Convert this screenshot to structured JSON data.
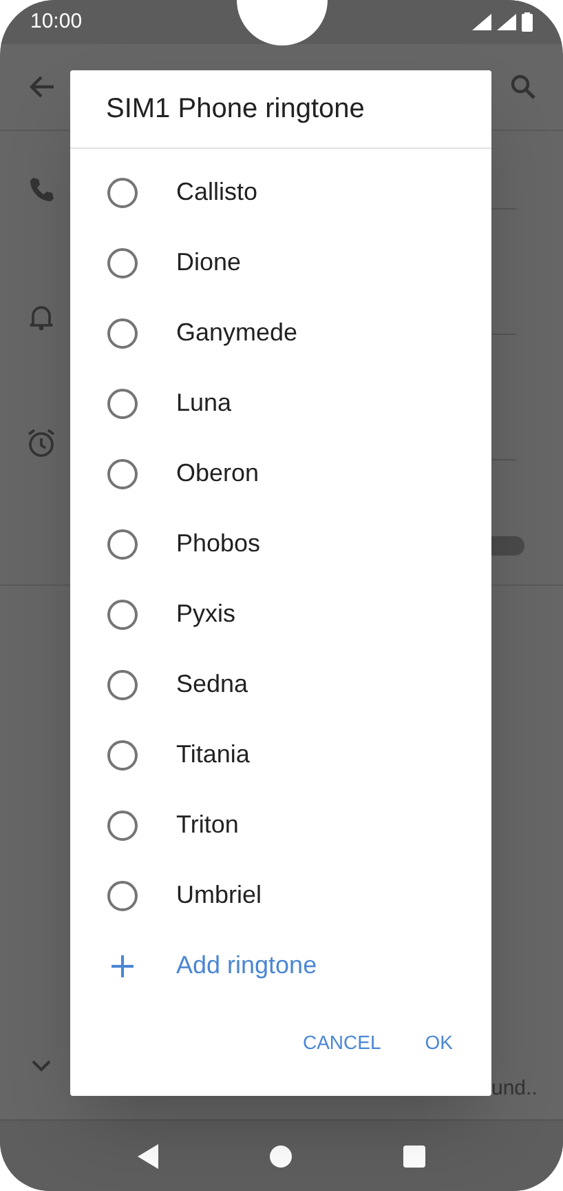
{
  "status_bar": {
    "time": "10:00"
  },
  "background": {
    "toggle": {
      "on": false
    },
    "truncated_text": "und.."
  },
  "dialog": {
    "title": "SIM1 Phone ringtone",
    "options": [
      {
        "label": "Callisto",
        "selected": false
      },
      {
        "label": "Dione",
        "selected": false
      },
      {
        "label": "Ganymede",
        "selected": false
      },
      {
        "label": "Luna",
        "selected": false
      },
      {
        "label": "Oberon",
        "selected": false
      },
      {
        "label": "Phobos",
        "selected": false
      },
      {
        "label": "Pyxis",
        "selected": false
      },
      {
        "label": "Sedna",
        "selected": false
      },
      {
        "label": "Titania",
        "selected": false
      },
      {
        "label": "Triton",
        "selected": false
      },
      {
        "label": "Umbriel",
        "selected": false
      }
    ],
    "add_ringtone": "Add ringtone",
    "buttons": [
      "CANCEL",
      "OK"
    ]
  }
}
